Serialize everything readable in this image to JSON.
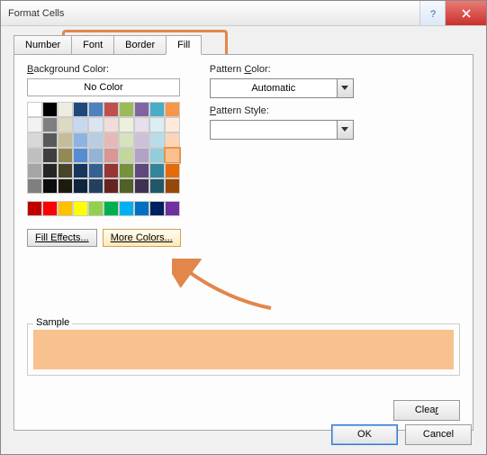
{
  "window": {
    "title": "Format Cells"
  },
  "tabs": {
    "items": [
      "Number",
      "Font",
      "Border",
      "Fill"
    ],
    "active": "Fill"
  },
  "left": {
    "bg_label": "Background Color:",
    "no_color": "No Color",
    "fill_effects": "Fill Effects...",
    "more_colors": "More Colors..."
  },
  "right": {
    "pattern_color_label": "Pattern Color:",
    "pattern_color_value": "Automatic",
    "pattern_style_label": "Pattern Style:",
    "pattern_style_value": ""
  },
  "sample": {
    "label": "Sample",
    "fill": "#f7c28f"
  },
  "buttons": {
    "clear": "Clear",
    "ok": "OK",
    "cancel": "Cancel"
  },
  "palette": {
    "theme": [
      [
        "#ffffff",
        "#000000",
        "#eeece1",
        "#1f497d",
        "#4f81bd",
        "#c0504d",
        "#9bbb59",
        "#8064a2",
        "#4bacc6",
        "#f79646"
      ],
      [
        "#f2f2f2",
        "#7f7f7f",
        "#ddd9c3",
        "#c6d9f0",
        "#dbe5f1",
        "#f2dcdb",
        "#ebf1dd",
        "#e5e0ec",
        "#dbeef3",
        "#fdeada"
      ],
      [
        "#d8d8d8",
        "#595959",
        "#c4bd97",
        "#8db3e2",
        "#b8cce4",
        "#e5b9b7",
        "#d7e3bc",
        "#ccc1d9",
        "#b7dde8",
        "#fbd5b5"
      ],
      [
        "#bfbfbf",
        "#3f3f3f",
        "#938953",
        "#548dd4",
        "#95b3d7",
        "#d99694",
        "#c3d69b",
        "#b2a2c7",
        "#92cddc",
        "#fac08f"
      ],
      [
        "#a5a5a5",
        "#262626",
        "#494429",
        "#17365d",
        "#366092",
        "#953734",
        "#76923c",
        "#5f497a",
        "#31859b",
        "#e36c09"
      ],
      [
        "#7f7f7f",
        "#0c0c0c",
        "#1d1b10",
        "#0f243e",
        "#244061",
        "#632423",
        "#4f6128",
        "#3f3151",
        "#205867",
        "#974806"
      ]
    ],
    "selected": [
      3,
      9
    ],
    "standard": [
      "#c00000",
      "#ff0000",
      "#ffc000",
      "#ffff00",
      "#92d050",
      "#00b050",
      "#00b0f0",
      "#0070c0",
      "#002060",
      "#7030a0"
    ]
  },
  "annotations": {
    "tabs_highlight": true,
    "arrow_to_more_colors": true
  }
}
